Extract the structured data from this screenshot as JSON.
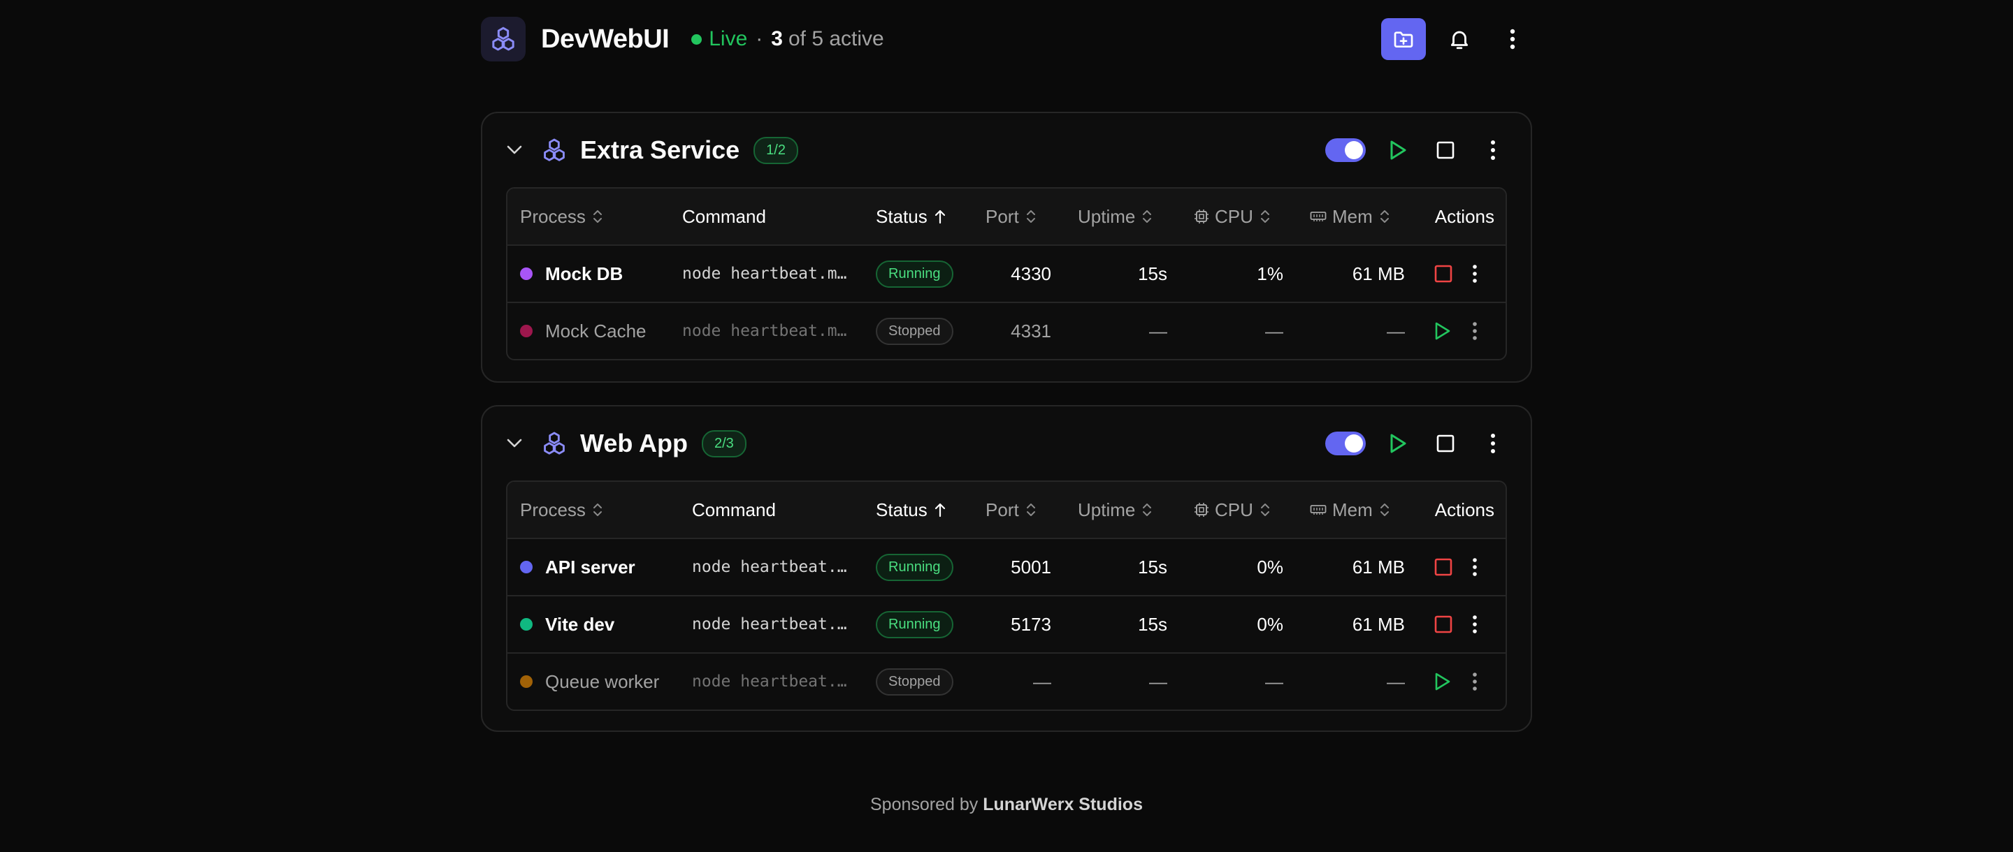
{
  "app": {
    "title": "DevWebUI",
    "status": "Live",
    "separator": "·",
    "active_count": "3",
    "active_text": "of 5 active"
  },
  "table_headers": {
    "process": "Process",
    "command": "Command",
    "status": "Status",
    "port": "Port",
    "uptime": "Uptime",
    "cpu": "CPU",
    "mem": "Mem",
    "actions": "Actions"
  },
  "groups": [
    {
      "title": "Extra Service",
      "badge": "1/2",
      "rows": [
        {
          "name": "Mock DB",
          "dot": "#a855f7",
          "command": "node heartbeat.mjs",
          "status": "Running",
          "port": "4330",
          "uptime": "15s",
          "cpu": "1%",
          "mem": "61 MB"
        },
        {
          "name": "Mock Cache",
          "dot": "#9d174d",
          "command": "node heartbeat.mjs",
          "status": "Stopped",
          "port": "4331",
          "uptime": "—",
          "cpu": "—",
          "mem": "—"
        }
      ]
    },
    {
      "title": "Web App",
      "badge": "2/3",
      "rows": [
        {
          "name": "API server",
          "dot": "#6366f1",
          "command": "node heartbeat.mjs",
          "status": "Running",
          "port": "5001",
          "uptime": "15s",
          "cpu": "0%",
          "mem": "61 MB"
        },
        {
          "name": "Vite dev",
          "dot": "#10b981",
          "command": "node heartbeat.mjs",
          "status": "Running",
          "port": "5173",
          "uptime": "15s",
          "cpu": "0%",
          "mem": "61 MB"
        },
        {
          "name": "Queue worker",
          "dot": "#a16207",
          "command": "node heartbeat.mjs",
          "status": "Stopped",
          "port": "—",
          "uptime": "—",
          "cpu": "—",
          "mem": "—"
        }
      ]
    }
  ],
  "footer": {
    "prefix": "Sponsored by",
    "sponsor": "LunarWerx Studios"
  },
  "colors": {
    "accent": "#6366f1",
    "running": "#22c55e",
    "stop_button": "#ef4444"
  }
}
